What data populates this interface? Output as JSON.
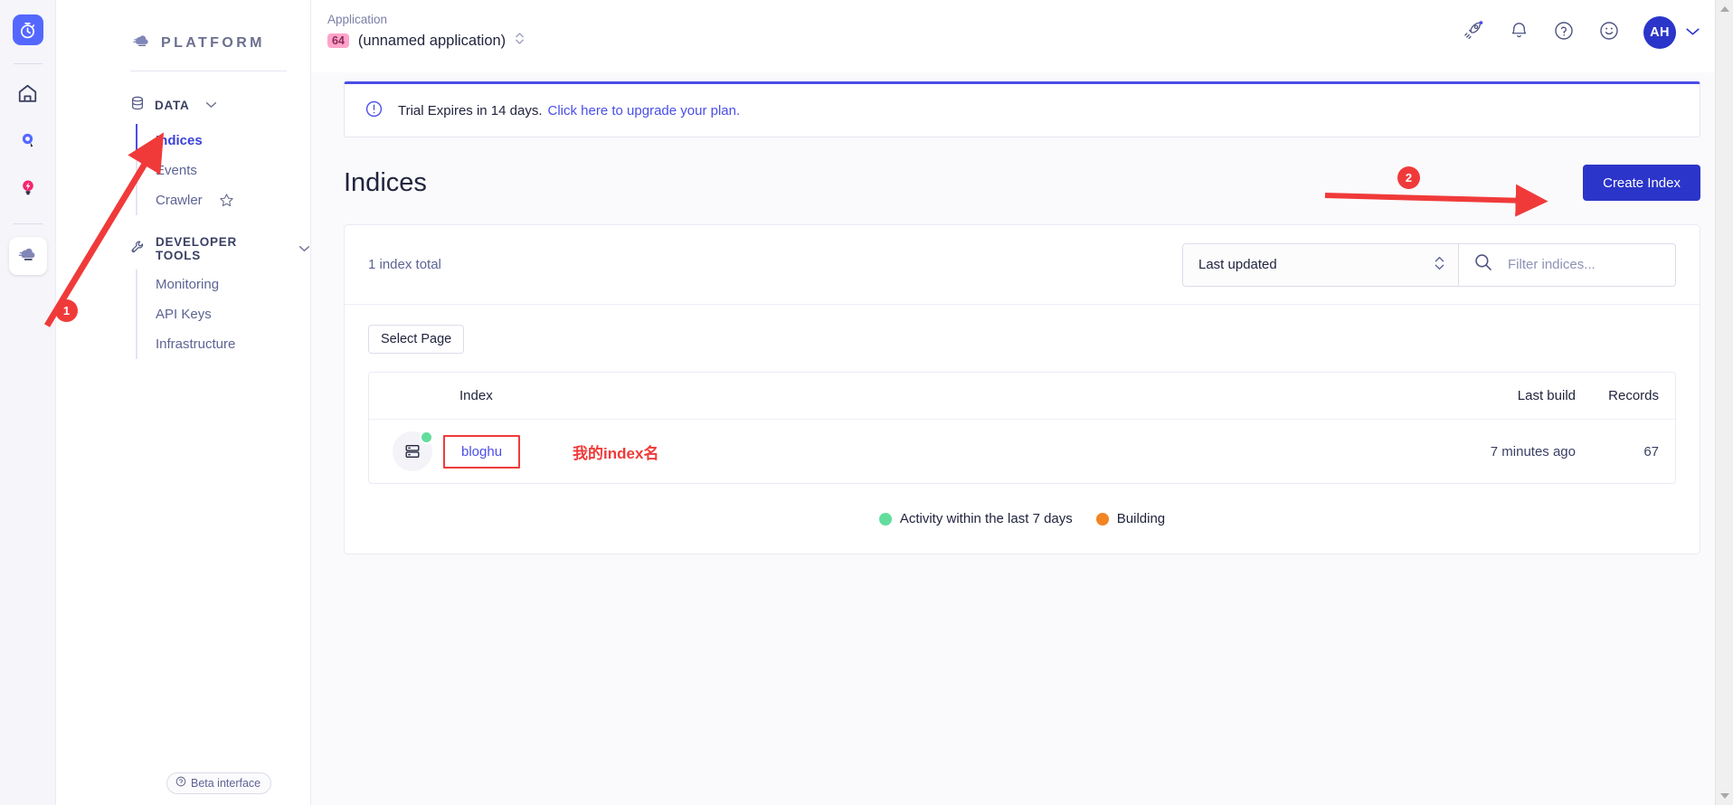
{
  "colors": {
    "brand_blue": "#4a4ee8",
    "primary_button": "#2b35c9",
    "annotation_red": "#f03a3a",
    "status_green": "#62dd9c",
    "status_orange": "#f28421",
    "badge_pink": "#ffa3c9"
  },
  "rail": {
    "logo_icon": "stopwatch-logo-icon",
    "items": [
      {
        "icon": "home-icon",
        "name": "home"
      },
      {
        "icon": "search-pin-icon",
        "name": "search"
      },
      {
        "icon": "bolt-pin-icon",
        "name": "recommend"
      },
      {
        "icon": "cloud-icon",
        "name": "platform",
        "active": true
      }
    ]
  },
  "sidebar": {
    "brand": "PLATFORM",
    "brand_icon": "cloud-icon",
    "sections": [
      {
        "label": "DATA",
        "icon": "database-icon",
        "chevron": "chevron-down-icon",
        "items": [
          {
            "label": "Indices",
            "active": true
          },
          {
            "label": "Events",
            "active": false
          },
          {
            "label": "Crawler",
            "active": false,
            "star": "star-icon"
          }
        ]
      },
      {
        "label": "DEVELOPER TOOLS",
        "icon": "wrench-icon",
        "chevron": "chevron-down-icon",
        "items": [
          {
            "label": "Monitoring",
            "active": false
          },
          {
            "label": "API Keys",
            "active": false
          },
          {
            "label": "Infrastructure",
            "active": false
          }
        ]
      }
    ],
    "beta_label": "Beta interface",
    "beta_icon": "info-circle-icon"
  },
  "topbar": {
    "app_label": "Application",
    "app_badge": "64",
    "app_name": "(unnamed application)",
    "app_switch_icon": "up-down-chevrons-icon",
    "icons": [
      {
        "name": "rocket-icon"
      },
      {
        "name": "bell-icon"
      },
      {
        "name": "help-circle-icon"
      },
      {
        "name": "smiley-icon"
      }
    ],
    "avatar_initials": "AH",
    "avatar_chevron": "chevron-down-icon"
  },
  "banner": {
    "icon": "alert-circle-icon",
    "text": "Trial Expires in 14 days.",
    "link_text": "Click here to upgrade your plan."
  },
  "page": {
    "title": "Indices",
    "create_button": "Create Index"
  },
  "toolbar": {
    "total_text": "1 index total",
    "sort_value": "Last updated",
    "sort_icon": "up-down-chevrons-icon",
    "search_icon": "search-icon",
    "search_placeholder": "Filter indices...",
    "search_value": ""
  },
  "table": {
    "select_page_label": "Select Page",
    "columns": {
      "index": "Index",
      "last_build": "Last build",
      "records": "Records"
    },
    "rows": [
      {
        "icon": "index-server-icon",
        "status": "active",
        "name": "bloghu",
        "last_build": "7 minutes ago",
        "records": "67"
      }
    ]
  },
  "legend": [
    {
      "color": "#62dd9c",
      "label": "Activity within the last 7 days"
    },
    {
      "color": "#f28421",
      "label": "Building"
    }
  ],
  "annotations": [
    {
      "number": "1",
      "target": "sidebar-indices-link"
    },
    {
      "number": "2",
      "target": "create-index-button"
    }
  ],
  "notes": {
    "index_name_note": "我的index名"
  }
}
